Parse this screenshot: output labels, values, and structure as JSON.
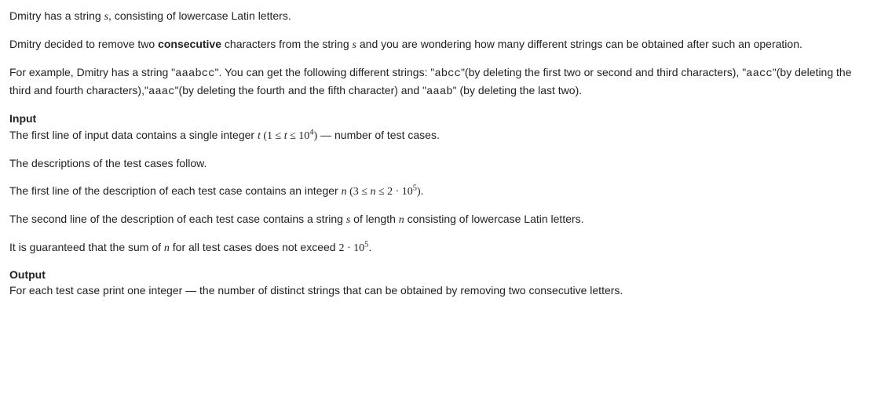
{
  "p1_a": "Dmitry has a string ",
  "p1_var_s": "s",
  "p1_b": ", consisting of lowercase Latin letters.",
  "p2_a": "Dmitry decided to remove two ",
  "p2_bold": "consecutive",
  "p2_b": " characters from the string ",
  "p2_var_s": "s",
  "p2_c": " and you are wondering how many different strings can be obtained after such an operation.",
  "p3_a": "For example, Dmitry has a string \"",
  "p3_code1": "aaabcc",
  "p3_b": "\". You can get the following different strings: \"",
  "p3_code2": "abcc",
  "p3_c": "\"(by deleting the first two or second and third characters), \"",
  "p3_code3": "aacc",
  "p3_d": "\"(by deleting the third and fourth characters),\"",
  "p3_code4": "aaac",
  "p3_e": "\"(by deleting the fourth and the fifth character) and \"",
  "p3_code5": "aaab",
  "p3_f": "\" (by deleting the last two).",
  "input_heading": "Input",
  "p4_a": "The first line of input data contains a single integer ",
  "p4_var_t": "t",
  "p4_lp": " (",
  "p4_one": "1",
  "p4_le1": " ≤ ",
  "p4_t2": "t",
  "p4_le2": " ≤ ",
  "p4_ten": "10",
  "p4_exp": "4",
  "p4_rp": ")",
  "p4_b": " — number of test cases.",
  "p5": "The descriptions of the test cases follow.",
  "p6_a": "The first line of the description of each test case contains an integer ",
  "p6_var_n": "n",
  "p6_lp": " (",
  "p6_three": "3",
  "p6_le1": " ≤ ",
  "p6_n2": "n",
  "p6_le2": " ≤ ",
  "p6_two": "2",
  "p6_dot": " · ",
  "p6_ten": "10",
  "p6_exp": "5",
  "p6_rp": ").",
  "p7_a": "The second line of the description of each test case contains a string ",
  "p7_var_s": "s",
  "p7_b": " of length ",
  "p7_var_n": "n",
  "p7_c": " consisting of lowercase Latin letters.",
  "p8_a": "It is guaranteed that the sum of ",
  "p8_var_n": "n",
  "p8_b": " for all test cases does not exceed ",
  "p8_two": "2",
  "p8_dot": " · ",
  "p8_ten": "10",
  "p8_exp": "5",
  "p8_c": ".",
  "output_heading": "Output",
  "p9": "For each test case print one integer — the number of distinct strings that can be obtained by removing two consecutive letters."
}
